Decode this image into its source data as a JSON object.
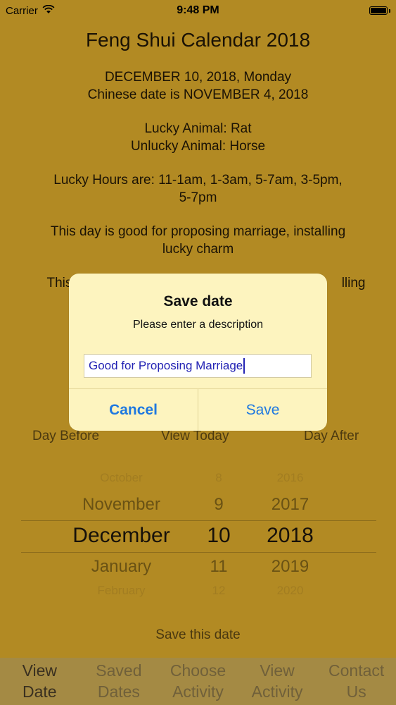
{
  "status": {
    "carrier": "Carrier",
    "time": "9:48 PM"
  },
  "main": {
    "title": "Feng Shui Calendar 2018",
    "date_line": "DECEMBER 10, 2018, Monday",
    "chinese_line": "Chinese date is NOVEMBER 4, 2018",
    "lucky_animal": "Lucky Animal: Rat",
    "unlucky_animal": "Unlucky Animal: Horse",
    "lucky_hours_1": "Lucky Hours are: 11-1am, 1-3am, 5-7am, 3-5pm,",
    "lucky_hours_2": "5-7pm",
    "good_for_1": "This day is good for proposing marriage, installing",
    "good_for_2": "lucky charm",
    "bad_for_left": "This",
    "bad_for_right": "lling"
  },
  "nav": {
    "day_before": "Day Before",
    "view_today": "View Today",
    "day_after": "Day After"
  },
  "picker": {
    "months": [
      "October",
      "November",
      "December",
      "January",
      "February"
    ],
    "days": [
      "8",
      "9",
      "10",
      "11",
      "12"
    ],
    "years": [
      "2016",
      "2017",
      "2018",
      "2019",
      "2020"
    ]
  },
  "save_this_date": "Save this date",
  "tabs": [
    {
      "line1": "View",
      "line2": "Date"
    },
    {
      "line1": "Saved",
      "line2": "Dates"
    },
    {
      "line1": "Choose",
      "line2": "Activity"
    },
    {
      "line1": "View",
      "line2": "Activity"
    },
    {
      "line1": "Contact",
      "line2": "Us"
    }
  ],
  "alert": {
    "title": "Save date",
    "message": "Please enter a description",
    "input_value": "Good for Proposing Marriage",
    "cancel_label": "Cancel",
    "save_label": "Save"
  },
  "colors": {
    "background": "#b28a23",
    "alert_background": "#fdf4bf",
    "button_blue": "#1e78e0",
    "tabbar": "#a48a44"
  }
}
